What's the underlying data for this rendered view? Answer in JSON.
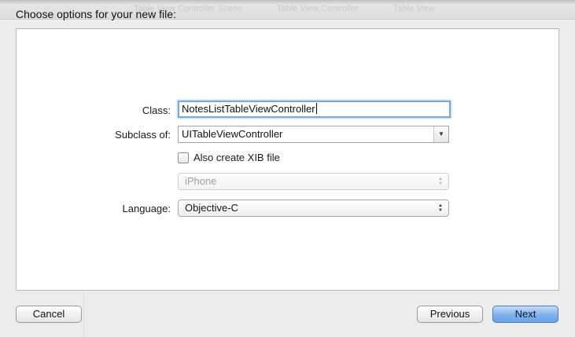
{
  "background": {
    "crumbs": [
      "Table View Controller Scene",
      "Table View Controller",
      "Table View"
    ]
  },
  "sheet": {
    "title": "Choose options for your new file:"
  },
  "form": {
    "class_label": "Class:",
    "class_value": "NotesListTableViewController",
    "subclass_label": "Subclass of:",
    "subclass_value": "UITableViewController",
    "xib_label": "Also create XIB file",
    "xib_checked": false,
    "device_value": "iPhone",
    "device_enabled": false,
    "language_label": "Language:",
    "language_value": "Objective-C"
  },
  "buttons": {
    "cancel": "Cancel",
    "previous": "Previous",
    "next": "Next"
  },
  "colors": {
    "focus_ring": "#7ba7d9",
    "primary_button": "#7fb1ec"
  }
}
